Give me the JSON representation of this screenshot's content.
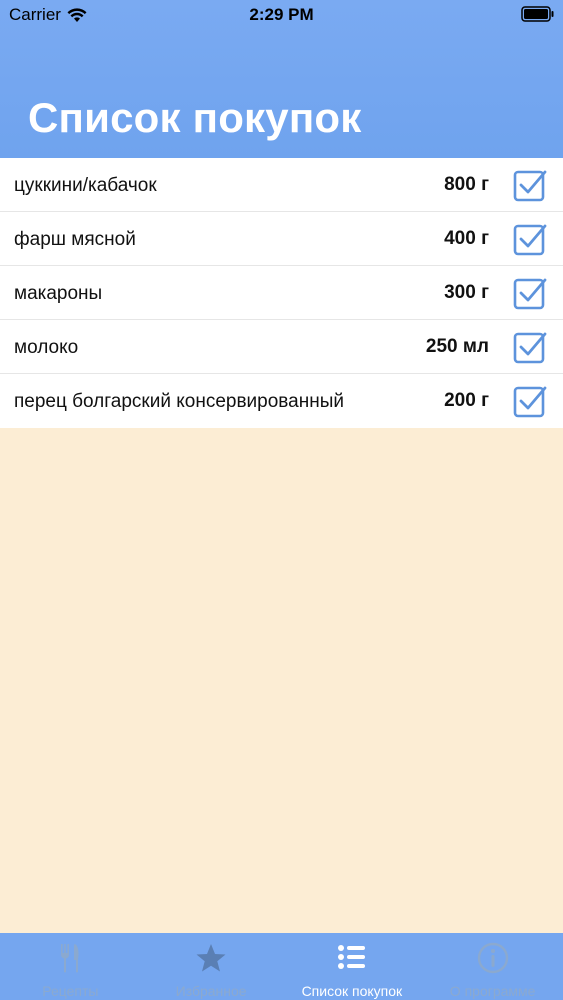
{
  "status": {
    "carrier": "Carrier",
    "time": "2:29 PM"
  },
  "header": {
    "title": "Список покупок"
  },
  "items": [
    {
      "name": "цуккини/кабачок",
      "qty": "800 г",
      "checked": true
    },
    {
      "name": "фарш мясной",
      "qty": "400 г",
      "checked": true
    },
    {
      "name": "макароны",
      "qty": "300 г",
      "checked": true
    },
    {
      "name": "молоко",
      "qty": "250 мл",
      "checked": true
    },
    {
      "name": "перец болгарский консервированный",
      "qty": "200 г",
      "checked": true
    }
  ],
  "tabs": [
    {
      "label": "Рецепты",
      "icon": "fork-knife-icon",
      "active": false
    },
    {
      "label": "Избранное",
      "icon": "star-icon",
      "active": false
    },
    {
      "label": "Список покупок",
      "icon": "list-icon",
      "active": true
    },
    {
      "label": "О программе",
      "icon": "info-icon",
      "active": false
    }
  ],
  "colors": {
    "header": "#75a6ef",
    "accent": "#5d93dc",
    "background": "#fcedd4"
  }
}
